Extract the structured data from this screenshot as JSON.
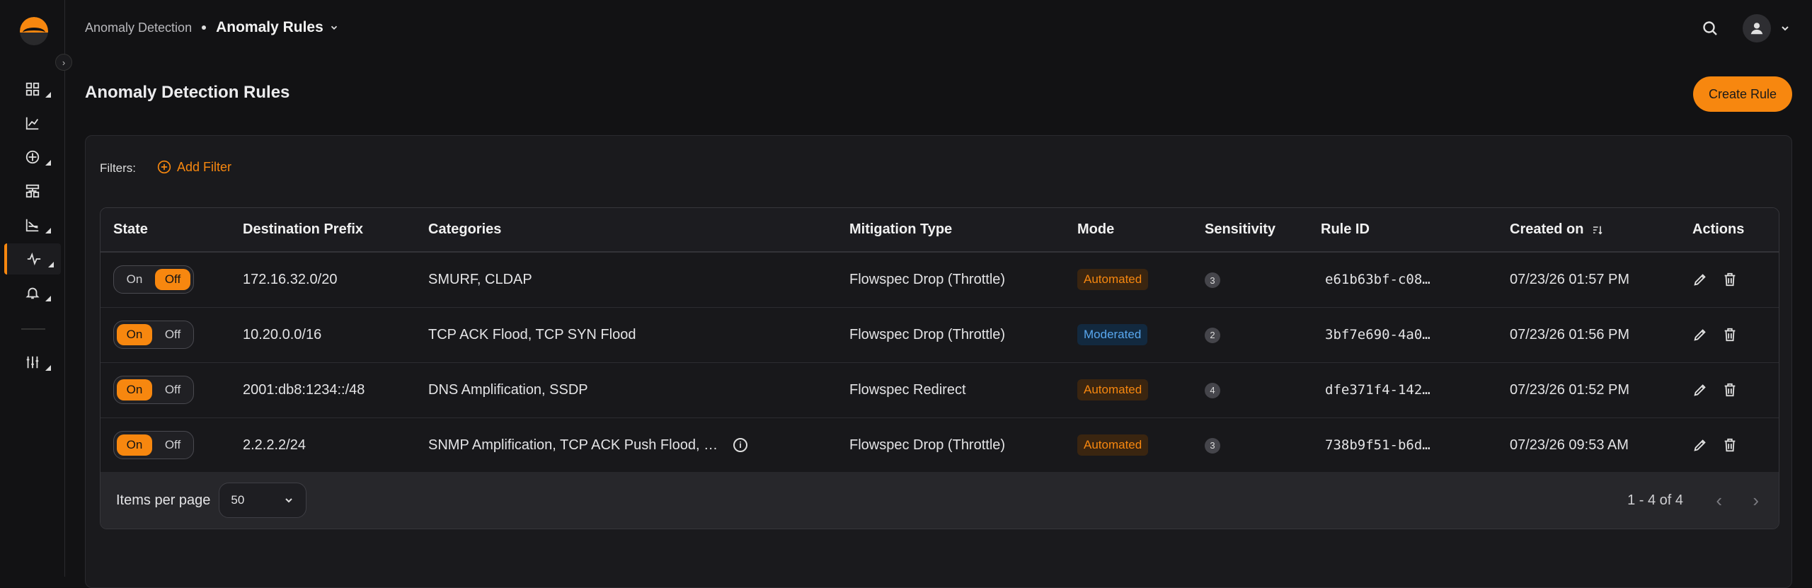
{
  "breadcrumb": {
    "root": "Anomaly Detection",
    "current": "Anomaly Rules"
  },
  "page": {
    "title": "Anomaly Detection Rules",
    "create_label": "Create Rule"
  },
  "filters": {
    "label": "Filters:",
    "add_label": "Add Filter"
  },
  "table": {
    "headers": {
      "state": "State",
      "prefix": "Destination Prefix",
      "categories": "Categories",
      "mitigation": "Mitigation Type",
      "mode": "Mode",
      "sensitivity": "Sensitivity",
      "rule_id": "Rule ID",
      "created": "Created on",
      "actions": "Actions"
    },
    "toggle_on": "On",
    "toggle_off": "Off",
    "rows": [
      {
        "state": "Off",
        "prefix": "172.16.32.0/20",
        "categories": "SMURF, CLDAP",
        "mitigation": "Flowspec Drop (Throttle)",
        "mode": "Automated",
        "sensitivity": "3",
        "rule_id": "e61b63bf-c08…",
        "created": "07/23/26 01:57 PM"
      },
      {
        "state": "On",
        "prefix": "10.20.0.0/16",
        "categories": "TCP ACK Flood, TCP SYN Flood",
        "mitigation": "Flowspec Drop (Throttle)",
        "mode": "Moderated",
        "sensitivity": "2",
        "rule_id": "3bf7e690-4a0…",
        "created": "07/23/26 01:56 PM"
      },
      {
        "state": "On",
        "prefix": "2001:db8:1234::/48",
        "categories": "DNS Amplification, SSDP",
        "mitigation": "Flowspec Redirect",
        "mode": "Automated",
        "sensitivity": "4",
        "rule_id": "dfe371f4-142…",
        "created": "07/23/26 01:52 PM"
      },
      {
        "state": "On",
        "prefix": "2.2.2.2/24",
        "categories": "SNMP Amplification, TCP ACK Push Flood, …",
        "mitigation": "Flowspec Drop (Throttle)",
        "mode": "Automated",
        "sensitivity": "3",
        "rule_id": "738b9f51-b6d…",
        "created": "07/23/26 09:53 AM"
      }
    ]
  },
  "pager": {
    "items_label": "Items per page",
    "items_value": "50",
    "range": "1 - 4 of 4"
  },
  "colors": {
    "accent": "#f7870f",
    "moderated": "#59a7ee",
    "background": "#121214"
  }
}
